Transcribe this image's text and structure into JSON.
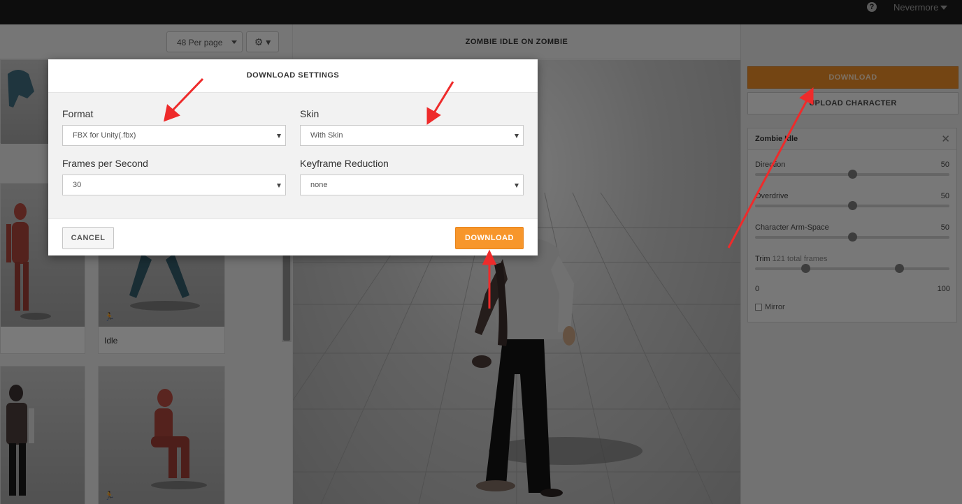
{
  "topbar": {
    "help_glyph": "?",
    "username": "Nevermore"
  },
  "library": {
    "per_page": "48 Per page",
    "gear_glyph": "⚙ ▾",
    "cards": [
      {
        "label": ""
      },
      {
        "label": "Idle"
      },
      {
        "label": ""
      },
      {
        "label": ""
      }
    ],
    "run_glyph": "🏃"
  },
  "viewport": {
    "title": "ZOMBIE IDLE ON ZOMBIE"
  },
  "sidebar": {
    "download_label": "DOWNLOAD",
    "upload_label": "UPLOAD CHARACTER",
    "animation": {
      "title": "Zombie Idle",
      "close_glyph": "✕",
      "sliders": [
        {
          "label": "Direction",
          "value": "50",
          "fraction": 0.5
        },
        {
          "label": "Overdrive",
          "value": "50",
          "fraction": 0.5
        },
        {
          "label": "Character Arm-Space",
          "value": "50",
          "fraction": 0.5
        }
      ],
      "trim": {
        "label": "Trim",
        "sub_label": "121 total frames",
        "min": "0",
        "max": "100",
        "start_fraction": 0.26,
        "end_fraction": 0.74
      },
      "mirror_label": "Mirror"
    }
  },
  "modal": {
    "title": "DOWNLOAD SETTINGS",
    "format_label": "Format",
    "format_value": "FBX for Unity(.fbx)",
    "skin_label": "Skin",
    "skin_value": "With Skin",
    "fps_label": "Frames per Second",
    "fps_value": "30",
    "keyframe_label": "Keyframe Reduction",
    "keyframe_value": "none",
    "cancel_label": "CANCEL",
    "download_label": "DOWNLOAD"
  },
  "colors": {
    "accent": "#f7962b",
    "annotation": "#ee2b2b"
  }
}
